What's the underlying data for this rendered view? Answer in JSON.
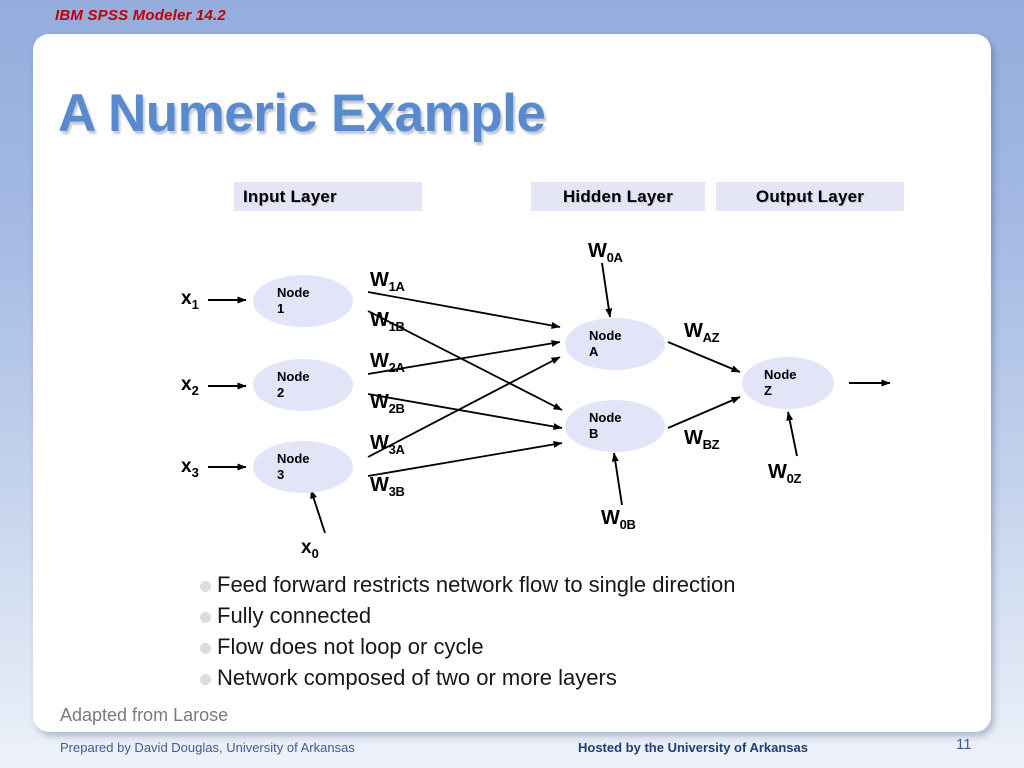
{
  "banner": {
    "product_title": "IBM SPSS Modeler 14.2",
    "product_title_color": "#C00000"
  },
  "slide": {
    "title": "A Numeric Example",
    "title_color": "#5A8ACE",
    "card_color": "#FFFFFF",
    "background_top_color": "#94ADDD",
    "background_bottom_color": "#EEF2FA"
  },
  "layers": {
    "input_label": "Input Layer",
    "hidden_label": "Hidden Layer",
    "output_label": "Output Layer",
    "chip_color": "#E4E6F7"
  },
  "diagram": {
    "node_fill_color": "#E2E5F8",
    "edge_color": "#000000",
    "input_nodes": [
      {
        "name": "Node",
        "index": "1"
      },
      {
        "name": "Node",
        "index": "2"
      },
      {
        "name": "Node",
        "index": "3"
      }
    ],
    "hidden_nodes": [
      {
        "name": "Node",
        "index": "A"
      },
      {
        "name": "Node",
        "index": "B"
      }
    ],
    "output_nodes": [
      {
        "name": "Node",
        "index": "Z"
      }
    ],
    "input_signals": [
      {
        "base": "x",
        "sub": "1"
      },
      {
        "base": "x",
        "sub": "2"
      },
      {
        "base": "x",
        "sub": "3"
      },
      {
        "base": "x",
        "sub": "0"
      }
    ],
    "weights": [
      {
        "base": "W",
        "sub": "1A"
      },
      {
        "base": "W",
        "sub": "1B"
      },
      {
        "base": "W",
        "sub": "2A"
      },
      {
        "base": "W",
        "sub": "2B"
      },
      {
        "base": "W",
        "sub": "3A"
      },
      {
        "base": "W",
        "sub": "3B"
      },
      {
        "base": "W",
        "sub": "0A"
      },
      {
        "base": "W",
        "sub": "0B"
      },
      {
        "base": "W",
        "sub": "AZ"
      },
      {
        "base": "W",
        "sub": "BZ"
      },
      {
        "base": "W",
        "sub": "0Z"
      }
    ]
  },
  "bullets": [
    "Feed forward restricts network flow to single direction",
    "Fully connected",
    "Flow does not loop or cycle",
    "Network composed of two or more layers"
  ],
  "notes": {
    "adapted_from": "Adapted from Larose"
  },
  "footer": {
    "prepared_by": "Prepared by David Douglas, University of Arkansas",
    "hosted_by": "Hosted by the University of Arkansas",
    "page_number": "11"
  }
}
